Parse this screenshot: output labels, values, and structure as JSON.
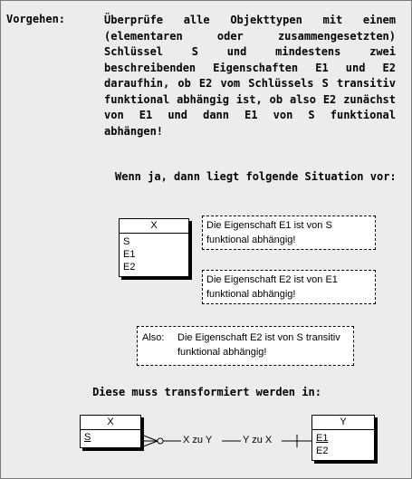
{
  "procedure": {
    "label": "Vorgehen:",
    "text": "Überprüfe alle Objekttypen mit einem (elementaren oder zusammengesetzten) Schlüssel S und mindestens zwei beschreibenden Eigenschaften E1 und E2 daraufhin, ob E2 vom Schlüssels S transitiv funktional abhängig ist, ob also E2 zunächst von E1 und dann E1 von S funktional abhängen!"
  },
  "situation": {
    "heading": "Wenn ja, dann liegt folgende Situation vor:",
    "entity": {
      "name": "X",
      "attributes": [
        "S",
        "E1",
        "E2"
      ]
    },
    "note1": "Die Eigenschaft E1 ist von S funktional abhängig!",
    "note2": "Die Eigenschaft E2 ist von E1 funktional abhängig!"
  },
  "conclusion": {
    "label": "Also:",
    "text": "Die Eigenschaft E2 ist von S transitiv funktional abhängig!"
  },
  "transform": {
    "heading": "Diese muss transformiert werden in:",
    "left_entity": {
      "name": "X",
      "attributes": [
        "S"
      ]
    },
    "right_entity": {
      "name": "Y",
      "attributes": [
        "E1",
        "E2"
      ]
    },
    "relation": {
      "left_label": "X zu Y",
      "right_label": "Y zu X"
    }
  }
}
